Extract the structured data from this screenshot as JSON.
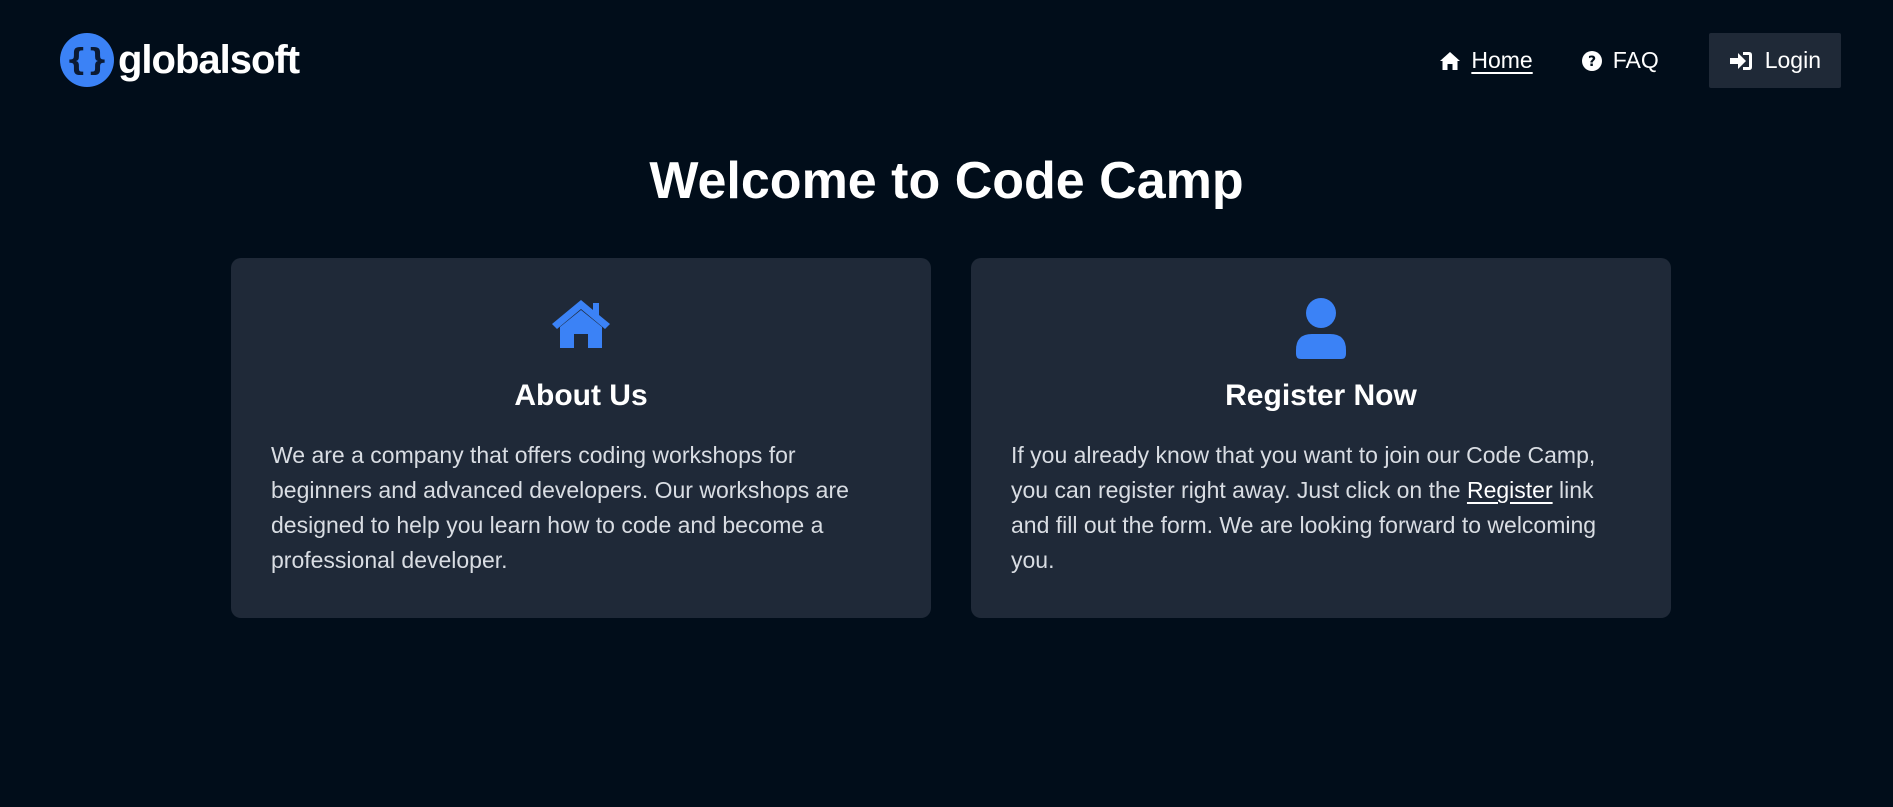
{
  "brand": {
    "name": "globalsoft",
    "logo_icon": "curly-braces-logo-icon",
    "accent_color": "#3b82f6"
  },
  "nav": {
    "home": {
      "label": "Home",
      "icon": "home-icon"
    },
    "faq": {
      "label": "FAQ",
      "icon": "question-circle-icon"
    },
    "login": {
      "label": "Login",
      "icon": "sign-in-icon"
    }
  },
  "main": {
    "title": "Welcome to Code Camp",
    "cards": [
      {
        "icon": "house-icon",
        "title": "About Us",
        "body": "We are a company that offers coding workshops for beginners and advanced developers. Our workshops are designed to help you learn how to code and become a professional developer."
      },
      {
        "icon": "user-icon",
        "title": "Register Now",
        "body_before": "If you already know that you want to join our Code Camp, you can register right away. Just click on the ",
        "link_label": "Register",
        "body_after": " link and fill out the form. We are looking forward to welcoming you."
      }
    ]
  },
  "colors": {
    "background": "#010d1a",
    "card": "#1f2938",
    "login_button": "#1f2937"
  }
}
